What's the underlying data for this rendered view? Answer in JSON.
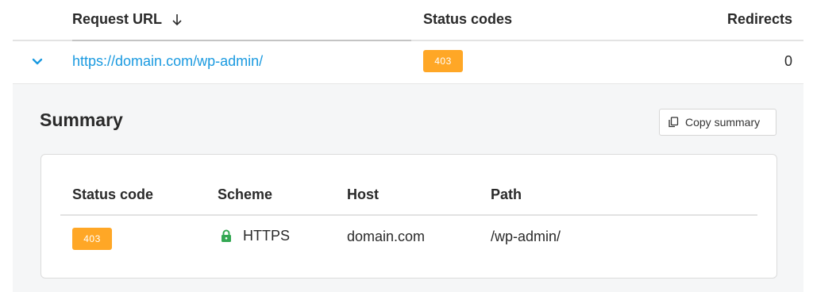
{
  "table": {
    "headers": {
      "request_url": "Request URL",
      "status_codes": "Status codes",
      "redirects": "Redirects"
    },
    "sort_icon": "arrow-down-icon",
    "row": {
      "expand_icon": "chevron-down-icon",
      "url": "https://domain.com/wp-admin/",
      "status_code": "403",
      "redirects": "0"
    }
  },
  "summary": {
    "title": "Summary",
    "copy_button": {
      "label": "Copy summary",
      "icon": "copy-icon"
    },
    "columns": {
      "status_code": "Status code",
      "scheme": "Scheme",
      "host": "Host",
      "path": "Path"
    },
    "values": {
      "status_code": "403",
      "scheme": "HTTPS",
      "scheme_icon": "lock-icon",
      "host": "domain.com",
      "path": "/wp-admin/"
    }
  },
  "colors": {
    "link": "#1a9ae0",
    "badge": "#ffa726",
    "lock": "#34a853",
    "panel_background": "#f5f6f7"
  }
}
